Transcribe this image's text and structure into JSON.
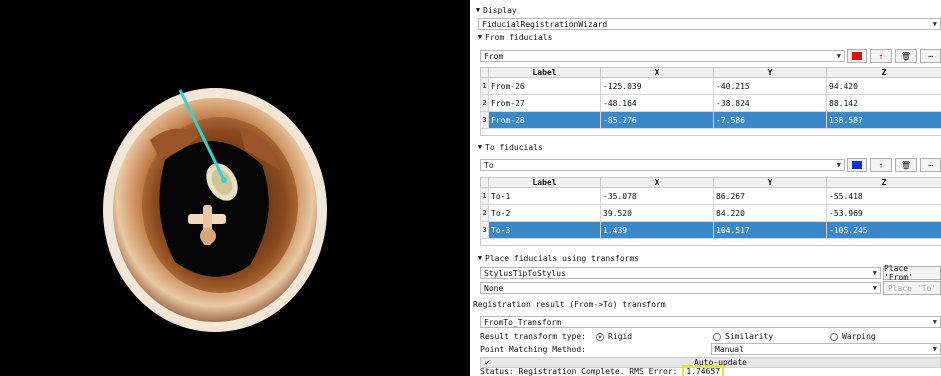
{
  "display_section": {
    "title": "Display",
    "module_selector": "FiducialRegistrationWizard"
  },
  "from_section": {
    "title": "From fiducials",
    "list_name": "From",
    "color": "#e01010",
    "columns": [
      "Label",
      "X",
      "Y",
      "Z"
    ],
    "rows": [
      {
        "index": "1",
        "label": "From-26",
        "x": "-125.039",
        "y": "-40.215",
        "z": "94.420"
      },
      {
        "index": "2",
        "label": "From-27",
        "x": "-48.164",
        "y": "-38.824",
        "z": "88.142"
      },
      {
        "index": "3",
        "label": "From-28",
        "x": "-85.276",
        "y": "-7.586",
        "z": "138.587"
      }
    ]
  },
  "to_section": {
    "title": "To fiducials",
    "list_name": "To",
    "color": "#1030e0",
    "columns": [
      "Label",
      "X",
      "Y",
      "Z"
    ],
    "rows": [
      {
        "index": "1",
        "label": "To-1",
        "x": "-35.078",
        "y": "86.267",
        "z": "-55.418"
      },
      {
        "index": "2",
        "label": "To-2",
        "x": "39.520",
        "y": "84.220",
        "z": "-53.969"
      },
      {
        "index": "3",
        "label": "To-3",
        "x": "1.439",
        "y": "104.517",
        "z": "-105.245"
      }
    ]
  },
  "place_section": {
    "title": "Place fiducials using transforms",
    "transform1": "StylusTipToStylus",
    "transform2": "None",
    "place_from_label": "Place 'From'",
    "place_to_label": "Place 'To'"
  },
  "result_section": {
    "title": "Registration result (From->To) transform",
    "transform": "FromTo_Transform",
    "type_label": "Result transform type:",
    "option_rigid": "Rigid",
    "option_similarity": "Similarity",
    "option_warping": "Warping",
    "selected_type": "Rigid",
    "matching_label": "Point Matching Method:",
    "matching_value": "Manual",
    "auto_update_label": "Auto-update",
    "auto_update_checked": "✔",
    "status_prefix": "Status: Registration Complete. RMS Error:",
    "rms_value": "1.74657"
  },
  "icons": {
    "collapse": "triangle-down-icon",
    "dropdown": "chevron-down-icon",
    "place": "place-fiducial-icon",
    "delete": "trash-icon",
    "more": "more-icon"
  }
}
